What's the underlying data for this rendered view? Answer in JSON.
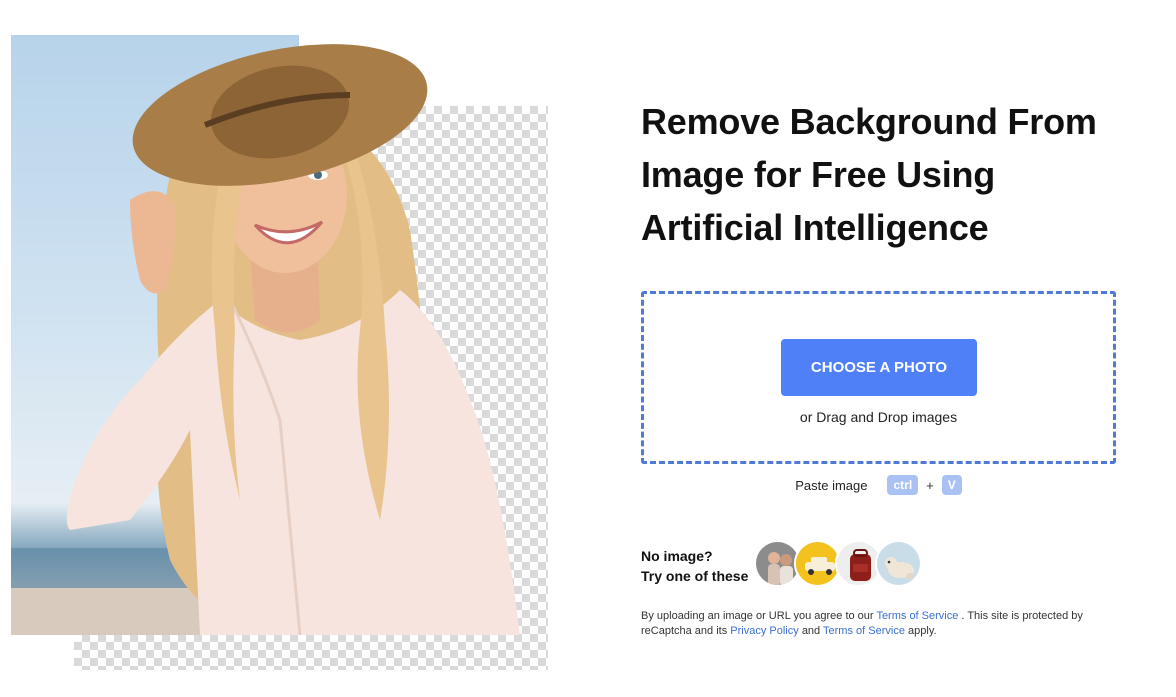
{
  "hero": {
    "image": "woman-with-hat-background-removed"
  },
  "title": {
    "line1": "Remove Background From",
    "line2": "Image for Free Using",
    "line3": "Artificial Intelligence"
  },
  "upload": {
    "button_label": "CHOOSE A PHOTO",
    "drag_text": "or Drag and Drop images"
  },
  "paste": {
    "label": "Paste image",
    "key1": "ctrl",
    "plus": "+",
    "key2": "V"
  },
  "samples": {
    "line1": "No image?",
    "line2": "Try one of these",
    "items": [
      "sample-people",
      "sample-car",
      "sample-bag",
      "sample-dog"
    ]
  },
  "legal": {
    "part1": "By uploading an image or URL you agree to our",
    "tos_link": "Terms of Service",
    "part2": ". This site is protected by reCaptcha and its",
    "privacy_link": "Privacy Policy",
    "part3": "and",
    "tos_link2": "Terms of Service",
    "part4": "apply."
  },
  "colors": {
    "accent": "#4f80f8",
    "dropzone_border": "#4f7ad6",
    "link": "#3b6fd0",
    "key_bg": "#a9c2f3"
  }
}
